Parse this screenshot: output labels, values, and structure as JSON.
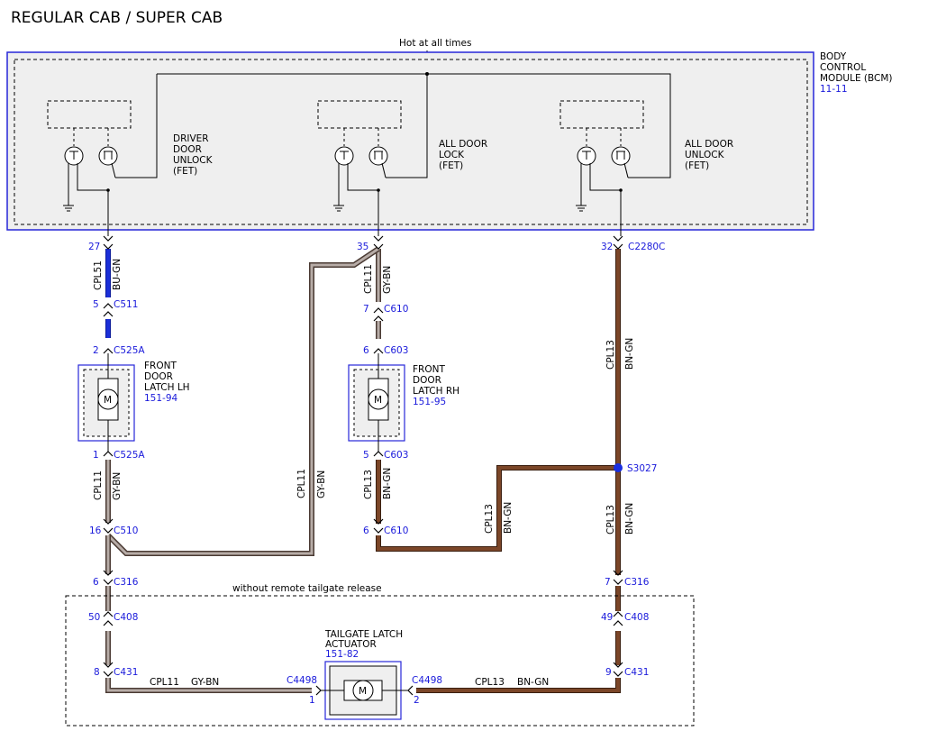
{
  "title": "REGULAR CAB / SUPER CAB",
  "hot_label": "Hot at all times",
  "bcm": {
    "line1": "BODY",
    "line2": "CONTROL",
    "line3": "MODULE (BCM)",
    "ref": "11-11"
  },
  "fets": {
    "driver_unlock": {
      "line1": "DRIVER",
      "line2": "DOOR",
      "line3": "UNLOCK",
      "line4": "(FET)"
    },
    "all_lock": {
      "line1": "ALL DOOR",
      "line2": "LOCK",
      "line3": "(FET)"
    },
    "all_unlock": {
      "line1": "ALL DOOR",
      "line2": "UNLOCK",
      "line3": "(FET)"
    }
  },
  "components": {
    "latch_lh": {
      "line1": "FRONT",
      "line2": "DOOR",
      "line3": "LATCH LH",
      "ref": "151-94",
      "symbol": "M"
    },
    "latch_rh": {
      "line1": "FRONT",
      "line2": "DOOR",
      "line3": "LATCH RH",
      "ref": "151-95",
      "symbol": "M"
    },
    "tailgate": {
      "line1": "TAILGATE LATCH",
      "line2": "ACTUATOR",
      "ref": "151-82",
      "symbol": "M"
    }
  },
  "option_label": "without remote tailgate release",
  "connectors": {
    "c2280c_27": {
      "pin": "27"
    },
    "c2280c_35": {
      "pin": "35"
    },
    "c2280c_32": {
      "pin": "32",
      "name": "C2280C"
    },
    "c511": {
      "pin": "5",
      "name": "C511"
    },
    "c525a_top": {
      "pin": "2",
      "name": "C525A"
    },
    "c525a_bot": {
      "pin": "1",
      "name": "C525A"
    },
    "c610_top": {
      "pin": "7",
      "name": "C610"
    },
    "c603_top": {
      "pin": "6",
      "name": "C603"
    },
    "c603_bot": {
      "pin": "5",
      "name": "C603"
    },
    "c510": {
      "pin": "16",
      "name": "C510"
    },
    "c610_bot": {
      "pin": "6",
      "name": "C610"
    },
    "s3027": {
      "name": "S3027"
    },
    "c316_left": {
      "pin": "6",
      "name": "C316"
    },
    "c316_right": {
      "pin": "7",
      "name": "C316"
    },
    "c408_left": {
      "pin": "50",
      "name": "C408"
    },
    "c408_right": {
      "pin": "49",
      "name": "C408"
    },
    "c431_left": {
      "pin": "8",
      "name": "C431"
    },
    "c431_right": {
      "pin": "9",
      "name": "C431"
    },
    "c4498_left": {
      "pin": "1",
      "name": "C4498"
    },
    "c4498_right": {
      "pin": "2",
      "name": "C4498"
    }
  },
  "wires": {
    "w_cpl51": {
      "circuit": "CPL51",
      "color": "BU-GN"
    },
    "w_cpl11_top": {
      "circuit": "CPL11",
      "color": "GY-BN"
    },
    "w_cpl13_top": {
      "circuit": "CPL13",
      "color": "BN-GN"
    },
    "w_cpl11_lh": {
      "circuit": "CPL11",
      "color": "GY-BN"
    },
    "w_cpl11_cross": {
      "circuit": "CPL11",
      "color": "GY-BN"
    },
    "w_cpl13_rh": {
      "circuit": "CPL13",
      "color": "BN-GN"
    },
    "w_cpl13_jog": {
      "circuit": "CPL13",
      "color": "BN-GN"
    },
    "w_cpl13_right": {
      "circuit": "CPL13",
      "color": "BN-GN"
    },
    "w_cpl11_bottom": {
      "circuit": "CPL11",
      "color": "GY-BN"
    },
    "w_cpl13_bottom": {
      "circuit": "CPL13",
      "color": "BN-GN"
    }
  },
  "colors": {
    "bu_gn": "#1b2fd8",
    "gy_bn": "#8a7f7a",
    "bn_gn": "#7b4628",
    "ref_blue": "#1a1adb",
    "module_fill": "#efefef"
  }
}
